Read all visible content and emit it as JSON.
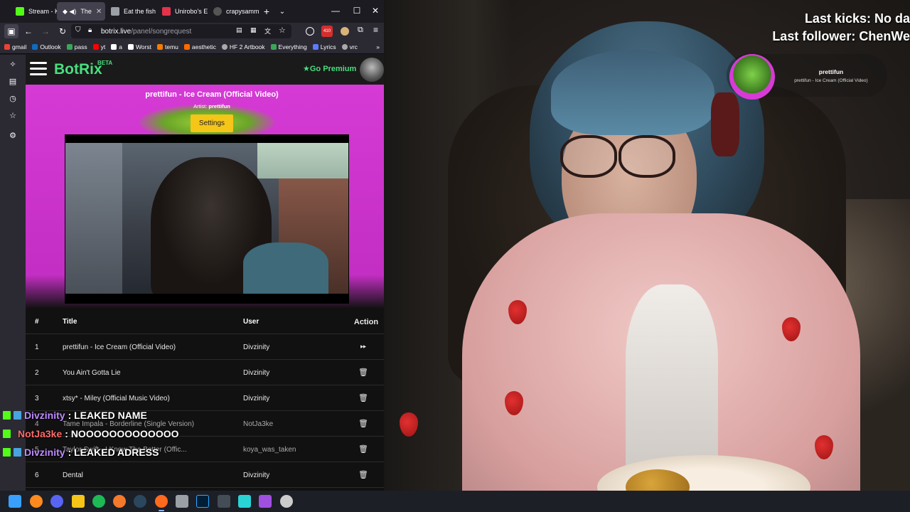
{
  "browser": {
    "tabs": [
      {
        "label": "Stream - Ki",
        "favicon_color": "#53fc18"
      },
      {
        "label": "The",
        "favicon_color": "#ffffff",
        "active": true
      },
      {
        "label": "Eat the fish",
        "favicon_color": "#cccccc"
      },
      {
        "label": "Unirobo's E",
        "favicon_color": "#e2334b"
      },
      {
        "label": "crapysamm",
        "favicon_color": "#cccccc"
      }
    ],
    "new_tab_label": "+",
    "url_domain": "botrix.live",
    "url_path": "/panel/songrequest",
    "notification_count": "410",
    "bookmarks": [
      {
        "label": "gmail",
        "color": "#ea4335"
      },
      {
        "label": "Outlook",
        "color": "#0f6cbd"
      },
      {
        "label": "pass",
        "color": "#3aa757"
      },
      {
        "label": "yt",
        "color": "#ff0000"
      },
      {
        "label": "a",
        "color": "#ffffff"
      },
      {
        "label": "Worst",
        "color": "#ffffff"
      },
      {
        "label": "temu",
        "color": "#f57c00"
      },
      {
        "label": "aesthetic",
        "color": "#ff6a00"
      },
      {
        "label": "HF 2 Artbook",
        "color": "#aaaaaa"
      },
      {
        "label": "Everything",
        "color": "#3aa757"
      },
      {
        "label": "Lyrics",
        "color": "#5b7cff"
      },
      {
        "label": "vrc",
        "color": "#aaaaaa"
      }
    ]
  },
  "site": {
    "logo": "BotRix",
    "logo_badge": "BETA",
    "premium_label": "Go Premium",
    "accent_color": "#4ade80"
  },
  "player": {
    "song_title": "prettifun - Ice Cream (Official Video)",
    "artist_label": "Artist:",
    "artist": "prettifun",
    "settings_label": "Settings",
    "bg_color": "#c832c8"
  },
  "queue": {
    "headers": {
      "num": "#",
      "title": "Title",
      "user": "User",
      "action": "Action"
    },
    "rows": [
      {
        "num": "1",
        "title": "prettifun - Ice Cream (Official Video)",
        "user": "Divzinity",
        "action": "skip-icon"
      },
      {
        "num": "2",
        "title": "You Ain't Gotta Lie",
        "user": "Divzinity",
        "action": "trash-icon"
      },
      {
        "num": "3",
        "title": "xtsy* - Miley (Official Music Video)",
        "user": "Divzinity",
        "action": "trash-icon"
      },
      {
        "num": "4",
        "title": "Tame Impala - Borderline (Single Version)",
        "user": "NotJa3ke",
        "action": "trash-icon"
      },
      {
        "num": "5",
        "title": "Taylor Swift - I Know The Better (Offic...",
        "user": "koya_was_taken",
        "action": "trash-icon"
      },
      {
        "num": "6",
        "title": "Dental",
        "user": "Divzinity",
        "action": "trash-icon"
      }
    ]
  },
  "chat": [
    {
      "user": "Divzinity",
      "message": ": LEAKED NAME",
      "color": "#c08cff"
    },
    {
      "user": "NotJa3ke",
      "message": ": NOOOOOOOOOOOOO",
      "color": "#ff6b6b"
    },
    {
      "user": "Divzinity",
      "message": ": LEAKED ADRESS",
      "color": "#c08cff"
    }
  ],
  "stream_overlay": {
    "last_kicks": "Last kicks: No da",
    "last_follower": "Last follower: ChenWe",
    "now_playing_artist": "prettifun",
    "now_playing_song": "prettifun - Ice Cream (Official Video)"
  },
  "taskbar": {
    "apps": [
      {
        "name": "windows-start-icon",
        "color": "#3aa0ff"
      },
      {
        "name": "firefox-app-icon",
        "color": "#ff8a1e"
      },
      {
        "name": "discord-app-icon",
        "color": "#5865f2"
      },
      {
        "name": "file-explorer-icon",
        "color": "#f5c518"
      },
      {
        "name": "spotify-app-icon",
        "color": "#1db954"
      },
      {
        "name": "blender-app-icon",
        "color": "#f5792a"
      },
      {
        "name": "steam-app-icon",
        "color": "#2a475e"
      },
      {
        "name": "firefox-active-icon",
        "color": "#ff6a1e"
      },
      {
        "name": "notepad-app-icon",
        "color": "#9aa0a6"
      },
      {
        "name": "photoshop-app-icon",
        "color": "#31a8ff"
      },
      {
        "name": "terminal-app-icon",
        "color": "#444c56"
      },
      {
        "name": "capcut-app-icon",
        "color": "#2bd4d4"
      },
      {
        "name": "obs-app-icon",
        "color": "#a050e0"
      },
      {
        "name": "settings-app-icon",
        "color": "#cccccc"
      }
    ]
  }
}
